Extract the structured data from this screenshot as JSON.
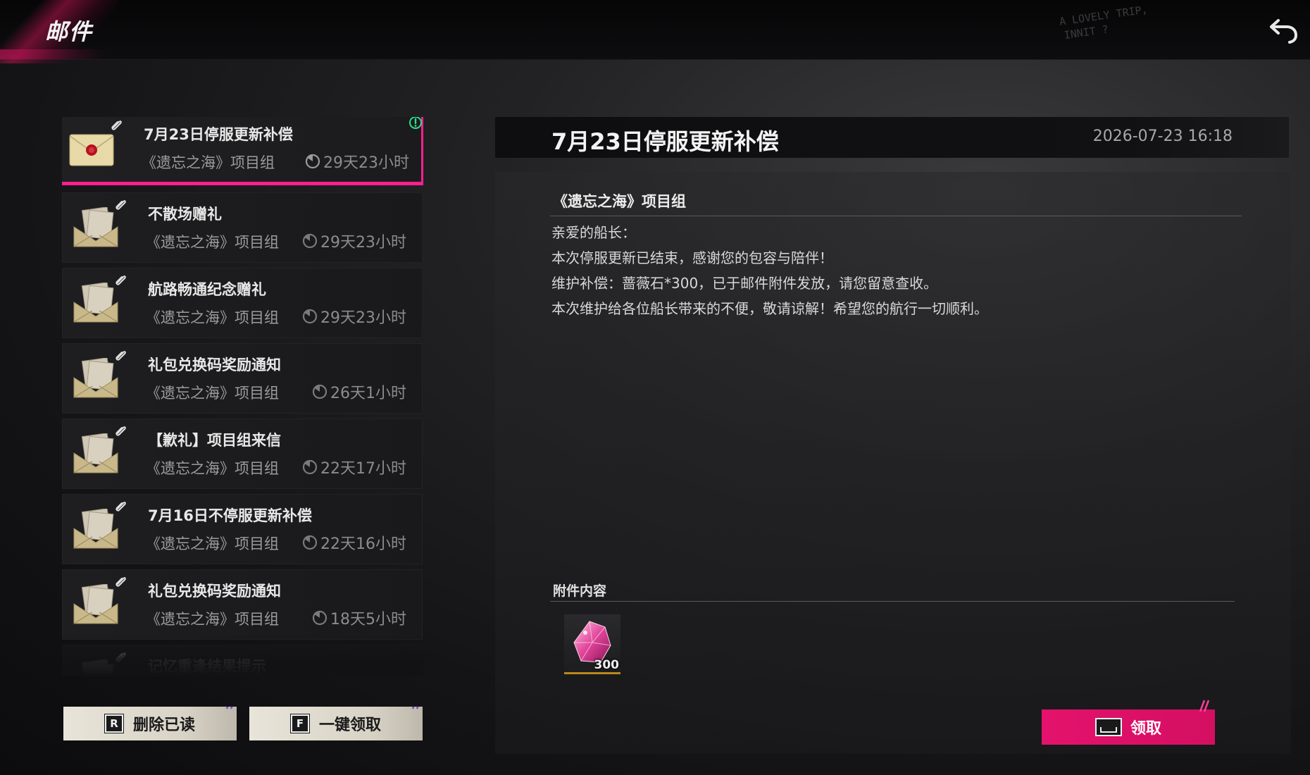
{
  "header": {
    "title": "邮件",
    "scribble": [
      "A LOVELY TRIP,",
      "INNIT ?"
    ]
  },
  "mail_list": [
    {
      "subject": "7月23日停服更新补偿",
      "sender": "《遗忘之海》项目组",
      "expires": "29天23小时",
      "selected": true,
      "unread": true
    },
    {
      "subject": "不散场赠礼",
      "sender": "《遗忘之海》项目组",
      "expires": "29天23小时"
    },
    {
      "subject": "航路畅通纪念赠礼",
      "sender": "《遗忘之海》项目组",
      "expires": "29天23小时"
    },
    {
      "subject": "礼包兑换码奖励通知",
      "sender": "《遗忘之海》项目组",
      "expires": "26天1小时"
    },
    {
      "subject": "【歉礼】项目组来信",
      "sender": "《遗忘之海》项目组",
      "expires": "22天17小时"
    },
    {
      "subject": "7月16日不停服更新补偿",
      "sender": "《遗忘之海》项目组",
      "expires": "22天16小时"
    },
    {
      "subject": "礼包兑换码奖励通知",
      "sender": "《遗忘之海》项目组",
      "expires": "18天5小时"
    },
    {
      "subject": "记忆重逢结果提示",
      "sender": "",
      "expires": ""
    }
  ],
  "buttons": {
    "delete_read": {
      "key": "R",
      "label": "删除已读"
    },
    "claim_all": {
      "key": "F",
      "label": "一键领取"
    },
    "claim": {
      "label": "领取"
    }
  },
  "detail": {
    "title": "7月23日停服更新补偿",
    "date": "2026-07-23 16:18",
    "sender": "《遗忘之海》项目组",
    "lines": [
      "亲爱的船长：",
      "本次停服更新已结束，感谢您的包容与陪伴！",
      "维护补偿：蔷薇石*300，已于邮件附件发放，请您留意查收。",
      "本次维护给各位船长带来的不便，敬请谅解！希望您的航行一切顺利。"
    ],
    "attachments_label": "附件内容",
    "attachments": [
      {
        "icon": "rose-crystal-icon",
        "count": "300"
      }
    ]
  },
  "colors": {
    "accent": "#ff1f8e",
    "claim_button": "#e4126c",
    "unread_badge": "#2ee08a"
  }
}
